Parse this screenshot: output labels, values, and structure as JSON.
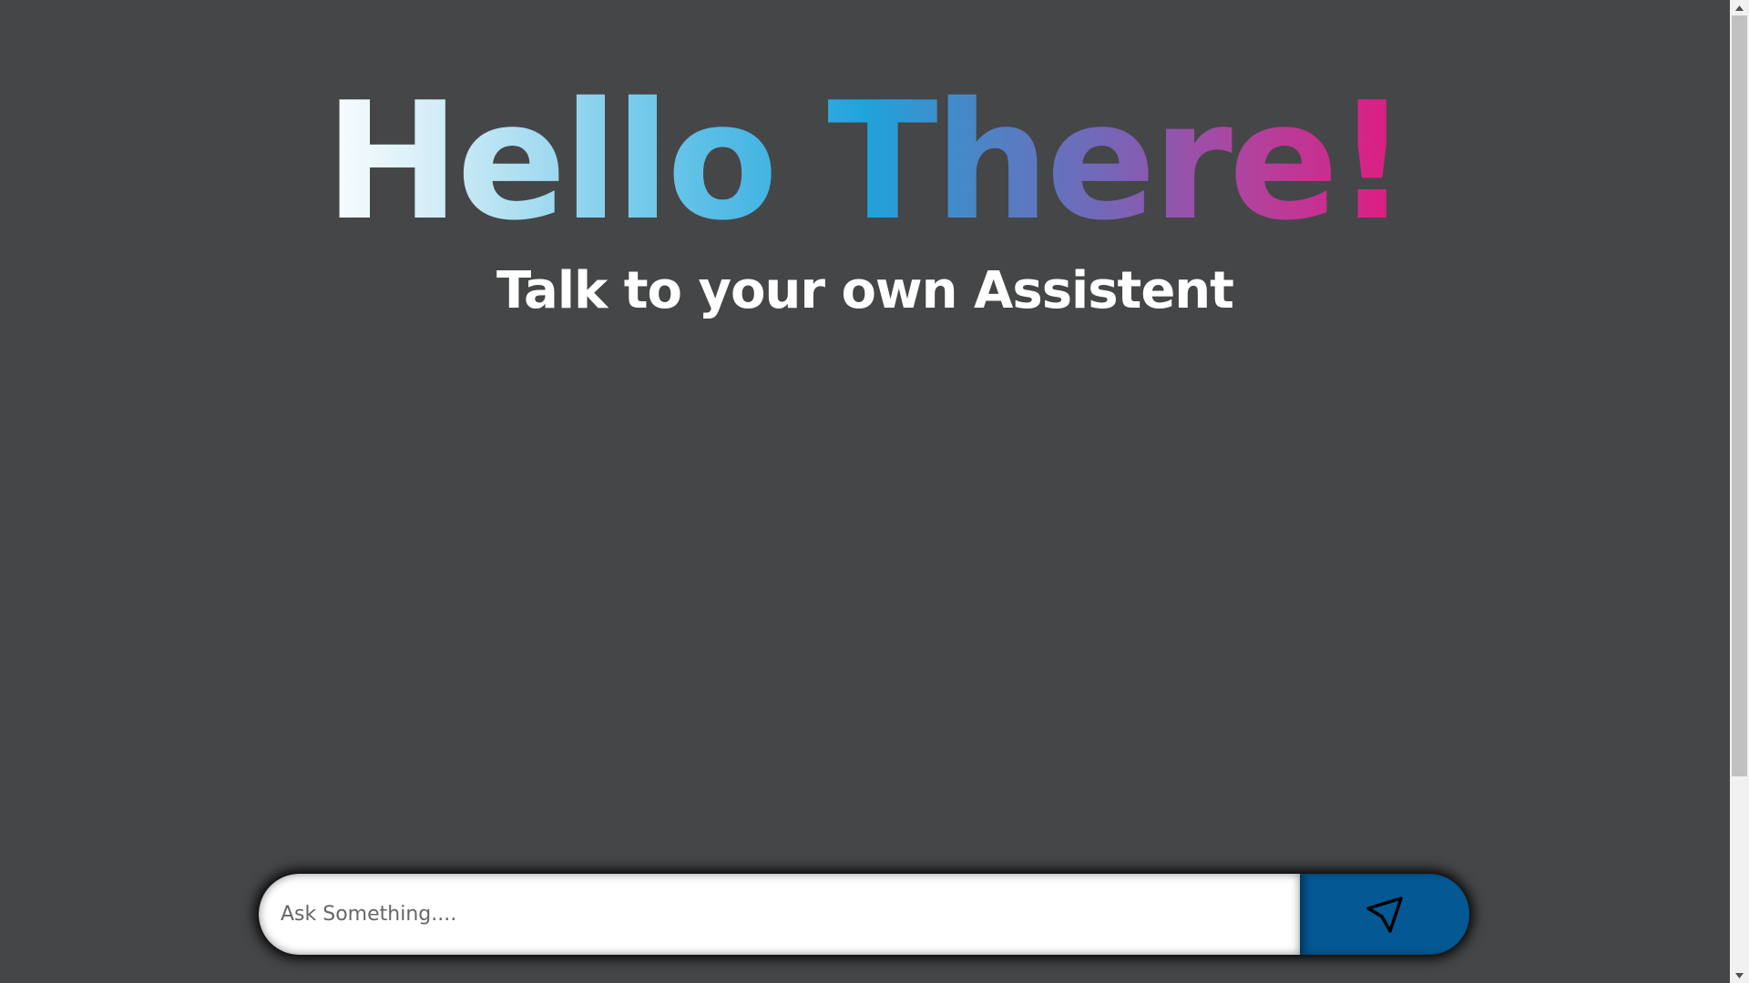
{
  "hero": {
    "title": "Hello There!",
    "subtitle": "Talk to your own Assistent"
  },
  "chat": {
    "input_value": "",
    "input_placeholder": "Ask Something....",
    "send_icon": "send-arrow-icon"
  },
  "colors": {
    "background": "#454648",
    "send_button": "#045894",
    "gradient_start": "#ffffff",
    "gradient_mid": "#1fa3dc",
    "gradient_end": "#e2197d"
  }
}
